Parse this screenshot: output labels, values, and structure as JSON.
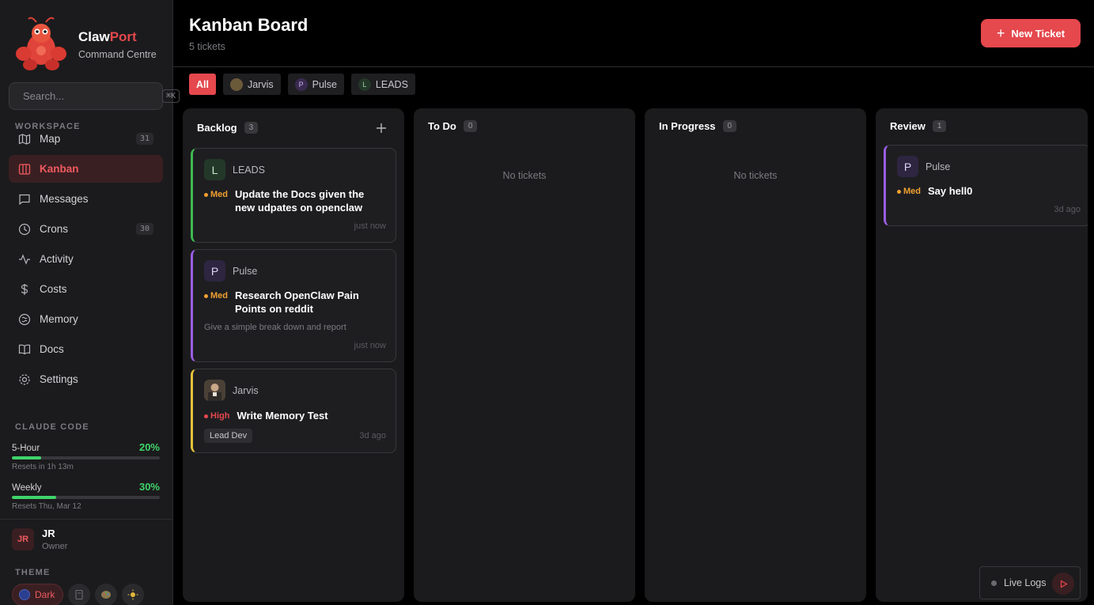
{
  "brand": {
    "name_a": "Claw",
    "name_b": "Port",
    "subtitle": "Command Centre"
  },
  "search": {
    "placeholder": "Search...",
    "shortcut": "⌘K"
  },
  "sidebar": {
    "workspace_label": "WORKSPACE",
    "items": [
      {
        "label": "Map",
        "icon": "map-icon",
        "count": "31"
      },
      {
        "label": "Kanban",
        "icon": "kanban-icon",
        "active": true
      },
      {
        "label": "Messages",
        "icon": "message-icon"
      },
      {
        "label": "Crons",
        "icon": "clock-icon",
        "count": "30"
      },
      {
        "label": "Activity",
        "icon": "activity-icon"
      },
      {
        "label": "Costs",
        "icon": "dollar-icon"
      },
      {
        "label": "Memory",
        "icon": "brain-icon"
      },
      {
        "label": "Docs",
        "icon": "book-icon"
      },
      {
        "label": "Settings",
        "icon": "gear-icon"
      }
    ],
    "claude_label": "CLAUDE CODE",
    "usage": [
      {
        "name": "5-Hour",
        "pct": "20%",
        "fill": 0.2,
        "reset": "Resets in 1h 13m"
      },
      {
        "name": "Weekly",
        "pct": "30%",
        "fill": 0.3,
        "reset": "Resets Thu, Mar 12"
      }
    ],
    "user": {
      "initials": "JR",
      "name": "JR",
      "role": "Owner"
    },
    "theme_label": "THEME",
    "theme_current": "Dark"
  },
  "header": {
    "title": "Kanban Board",
    "subtitle": "5 tickets",
    "new_ticket": "New Ticket"
  },
  "filters": [
    {
      "label": "All",
      "active": true
    },
    {
      "label": "Jarvis"
    },
    {
      "label": "Pulse",
      "initial": "P"
    },
    {
      "label": "LEADS",
      "initial": "L"
    }
  ],
  "columns": {
    "backlog": {
      "title": "Backlog",
      "count": "3"
    },
    "todo": {
      "title": "To Do",
      "count": "0",
      "empty": "No tickets"
    },
    "progress": {
      "title": "In Progress",
      "count": "0",
      "empty": "No tickets"
    },
    "review": {
      "title": "Review",
      "count": "1"
    }
  },
  "cards": {
    "c1": {
      "owner_initial": "L",
      "owner": "LEADS",
      "priority": "Med",
      "title": "Update the Docs given the new udpates on openclaw",
      "time": "just now",
      "accent": "#3fb950"
    },
    "c2": {
      "owner_initial": "P",
      "owner": "Pulse",
      "priority": "Med",
      "title": "Research OpenClaw Pain Points on reddit",
      "desc": "Give a simple break down and report",
      "time": "just now",
      "accent": "#9b5de5"
    },
    "c3": {
      "owner": "Jarvis",
      "priority": "High",
      "title": "Write Memory Test",
      "tag": "Lead Dev",
      "time": "3d ago",
      "accent": "#e5c33a"
    },
    "c4": {
      "owner_initial": "P",
      "owner": "Pulse",
      "priority": "Med",
      "title": "Say hell0",
      "time": "3d ago",
      "accent": "#9b5de5"
    }
  },
  "live_logs": "Live Logs",
  "colors": {
    "accent": "#e5484d",
    "med": "#f0a030",
    "high": "#e5484d",
    "success": "#3fd46a"
  }
}
